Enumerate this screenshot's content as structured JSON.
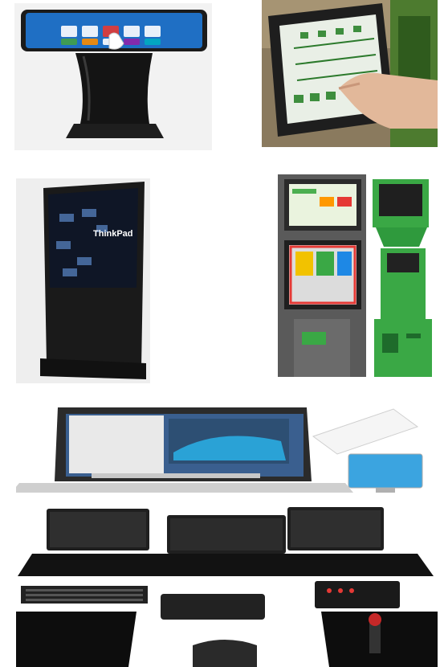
{
  "gallery": {
    "images": [
      {
        "subject": "kiosk-touch-table",
        "screen_color": "#1f6fc4"
      },
      {
        "subject": "tractor-touch-display"
      },
      {
        "subject": "digital-signage-totem",
        "screen_text": "ThinkPad"
      },
      {
        "subject": "self-service-kiosks",
        "kiosk_color": "#3aa845"
      },
      {
        "subject": "workstation-laptop-monitors"
      }
    ]
  }
}
